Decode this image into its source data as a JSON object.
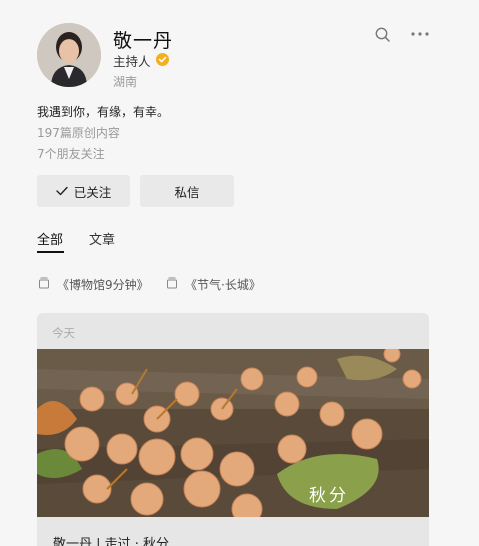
{
  "profile": {
    "name": "敬一丹",
    "role": "主持人",
    "region": "湖南",
    "bio": "我遇到你，有缘，有幸。",
    "originals": "197篇原创内容",
    "friends": "7个朋友关注",
    "verified_color": "#f2b01e"
  },
  "actions": {
    "follow_label": "已关注",
    "message_label": "私信"
  },
  "tabs": [
    {
      "label": "全部",
      "active": true
    },
    {
      "label": "文章",
      "active": false
    }
  ],
  "collections": [
    {
      "label": "《博物馆9分钟》"
    },
    {
      "label": "《节气·长城》"
    }
  ],
  "feed": {
    "date": "今天",
    "image_caption": "秋分",
    "title": "敬一丹 | 走过 · 秋分"
  },
  "icons": {
    "search": "search-icon",
    "more": "more-icon",
    "check": "check-icon",
    "collection": "collection-icon",
    "verified": "verified-badge-icon"
  }
}
